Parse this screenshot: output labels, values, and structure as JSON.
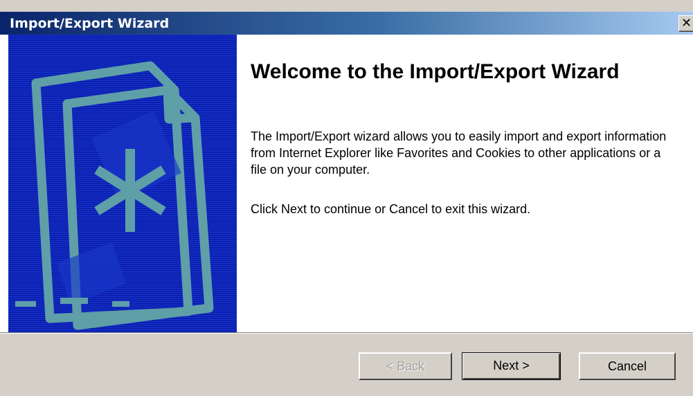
{
  "window": {
    "title": "Import/Export Wizard",
    "close_glyph": "✕"
  },
  "banner": {
    "image": "wizard-folder-asterisk-graphic",
    "colors": {
      "background": "#0a1fae",
      "artwork": "#5f9fa8"
    }
  },
  "welcome": {
    "heading": "Welcome to the Import/Export Wizard",
    "description": "The Import/Export wizard allows you to easily import and export information from Internet Explorer like Favorites and Cookies to other applications or a file on your computer.",
    "instruction": "Click Next to continue or Cancel to exit this wizard."
  },
  "buttons": {
    "back": "< Back",
    "next": "Next >",
    "cancel": "Cancel"
  }
}
